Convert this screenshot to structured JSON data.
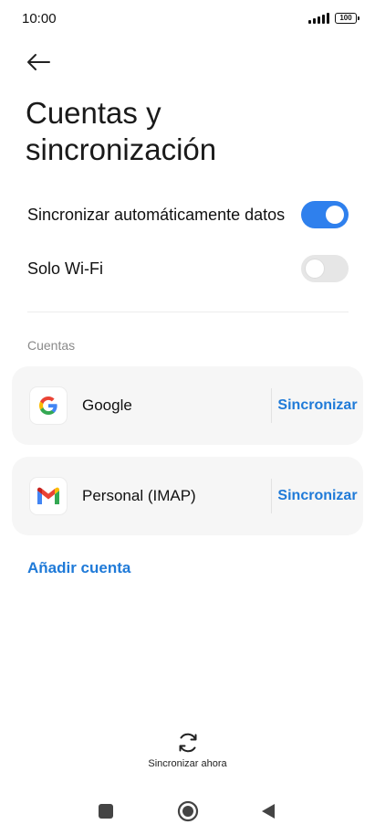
{
  "status_bar": {
    "time": "10:00",
    "battery": "100"
  },
  "header": {
    "title": "Cuentas y sincronización"
  },
  "settings": [
    {
      "label": "Sincronizar automáticamente datos",
      "enabled": true
    },
    {
      "label": "Solo Wi-Fi",
      "enabled": false
    }
  ],
  "accounts_section": {
    "label": "Cuentas",
    "items": [
      {
        "name": "Google",
        "icon": "google-logo-icon",
        "action": "Sincronizar"
      },
      {
        "name": "Personal (IMAP)",
        "icon": "gmail-logo-icon",
        "action": "Sincronizar"
      }
    ],
    "add_label": "Añadir cuenta"
  },
  "sync_now": {
    "label": "Sincronizar ahora",
    "icon": "sync-icon"
  },
  "colors": {
    "accent": "#1f7ad8",
    "toggle_on": "#2f80ed",
    "toggle_off": "#e6e6e6",
    "card_bg": "#f6f6f6"
  }
}
